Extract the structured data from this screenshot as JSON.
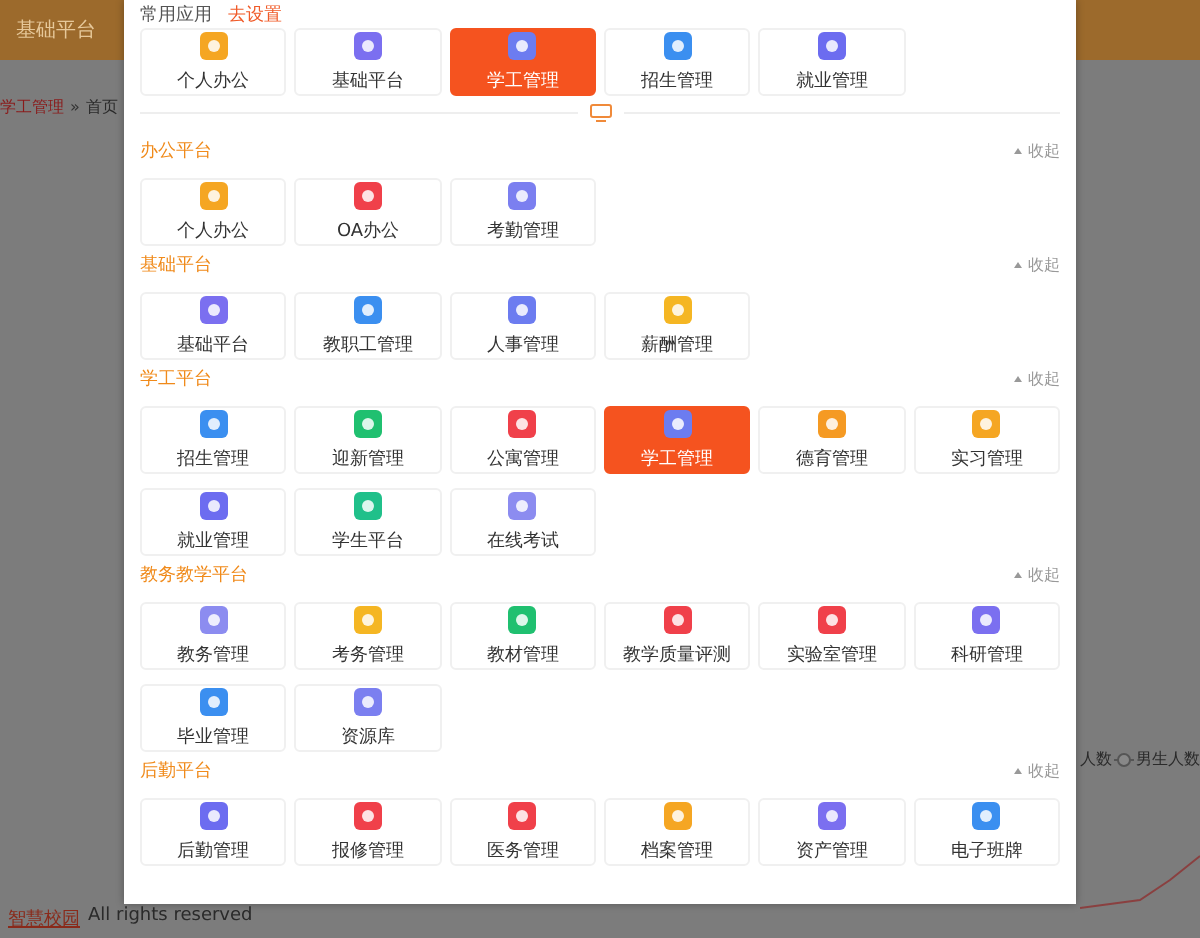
{
  "background": {
    "top_bar": {
      "title": "基础平台"
    },
    "breadcrumb": [
      "学工管理",
      "首页"
    ],
    "breadcrumb_separator": "»",
    "legend": [
      "人数",
      "男生人数"
    ],
    "footer": {
      "brand": "智慧校园",
      "text": "All rights reserved"
    }
  },
  "dialog": {
    "favorites": {
      "title": "常用应用",
      "action": "去设置",
      "apps": [
        {
          "label": "个人办公",
          "color": "#f5a623",
          "selected": false
        },
        {
          "label": "基础平台",
          "color": "#7b6ff0",
          "selected": false
        },
        {
          "label": "学工管理",
          "color": "#6c7cf0",
          "selected": true
        },
        {
          "label": "招生管理",
          "color": "#3b8ff0",
          "selected": false
        },
        {
          "label": "就业管理",
          "color": "#6c6cf0",
          "selected": false
        }
      ]
    },
    "sections": [
      {
        "title": "办公平台",
        "toggle": "收起",
        "apps": [
          {
            "label": "个人办公",
            "color": "#f5a623",
            "selected": false
          },
          {
            "label": "OA办公",
            "color": "#f0404a",
            "selected": false
          },
          {
            "label": "考勤管理",
            "color": "#7b7ff0",
            "selected": false
          }
        ]
      },
      {
        "title": "基础平台",
        "toggle": "收起",
        "apps": [
          {
            "label": "基础平台",
            "color": "#7b6ff0",
            "selected": false
          },
          {
            "label": "教职工管理",
            "color": "#3b8ff0",
            "selected": false
          },
          {
            "label": "人事管理",
            "color": "#6c7cf0",
            "selected": false
          },
          {
            "label": "薪酬管理",
            "color": "#f5b623",
            "selected": false
          }
        ]
      },
      {
        "title": "学工平台",
        "toggle": "收起",
        "apps": [
          {
            "label": "招生管理",
            "color": "#3b8ff0",
            "selected": false
          },
          {
            "label": "迎新管理",
            "color": "#20c070",
            "selected": false
          },
          {
            "label": "公寓管理",
            "color": "#f0404a",
            "selected": false
          },
          {
            "label": "学工管理",
            "color": "#6c7cf0",
            "selected": true
          },
          {
            "label": "德育管理",
            "color": "#f59a23",
            "selected": false
          },
          {
            "label": "实习管理",
            "color": "#f5a623",
            "selected": false
          },
          {
            "label": "就业管理",
            "color": "#6c6cf0",
            "selected": false
          },
          {
            "label": "学生平台",
            "color": "#20c08a",
            "selected": false
          },
          {
            "label": "在线考试",
            "color": "#8c8cf0",
            "selected": false
          }
        ]
      },
      {
        "title": "教务教学平台",
        "toggle": "收起",
        "apps": [
          {
            "label": "教务管理",
            "color": "#8c8cf0",
            "selected": false
          },
          {
            "label": "考务管理",
            "color": "#f5b623",
            "selected": false
          },
          {
            "label": "教材管理",
            "color": "#20c070",
            "selected": false
          },
          {
            "label": "教学质量评测",
            "color": "#f0404a",
            "selected": false
          },
          {
            "label": "实验室管理",
            "color": "#f0404a",
            "selected": false
          },
          {
            "label": "科研管理",
            "color": "#7b6ff0",
            "selected": false
          },
          {
            "label": "毕业管理",
            "color": "#3b8ff0",
            "selected": false
          },
          {
            "label": "资源库",
            "color": "#7b7ff0",
            "selected": false
          }
        ]
      },
      {
        "title": "后勤平台",
        "toggle": "收起",
        "apps": [
          {
            "label": "后勤管理",
            "color": "#6c6cf0",
            "selected": false
          },
          {
            "label": "报修管理",
            "color": "#f0404a",
            "selected": false
          },
          {
            "label": "医务管理",
            "color": "#f0404a",
            "selected": false
          },
          {
            "label": "档案管理",
            "color": "#f5a623",
            "selected": false
          },
          {
            "label": "资产管理",
            "color": "#7b6ff0",
            "selected": false
          },
          {
            "label": "电子班牌",
            "color": "#3b8ff0",
            "selected": false
          }
        ]
      }
    ]
  }
}
